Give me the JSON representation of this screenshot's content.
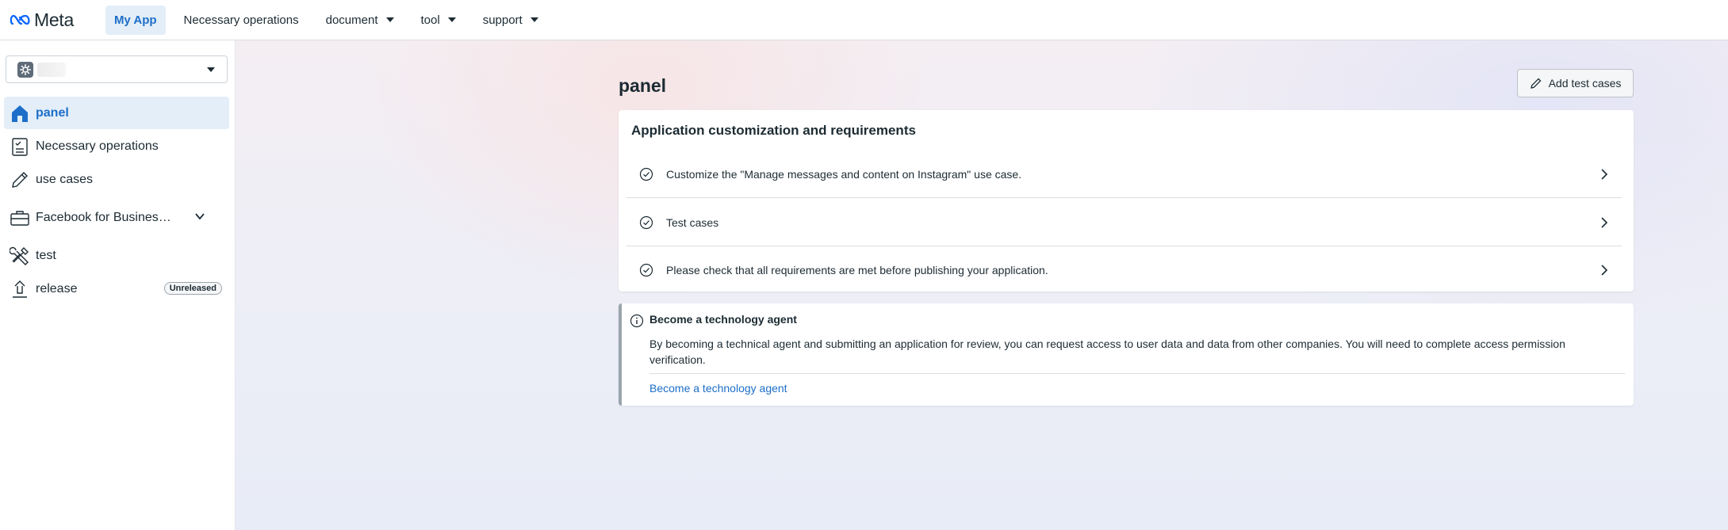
{
  "brand": {
    "name": "Meta"
  },
  "topnav": {
    "items": [
      {
        "label": "My App",
        "active": true,
        "dropdown": false
      },
      {
        "label": "Necessary operations",
        "active": false,
        "dropdown": false
      },
      {
        "label": "document",
        "active": false,
        "dropdown": true
      },
      {
        "label": "tool",
        "active": false,
        "dropdown": true
      },
      {
        "label": "support",
        "active": false,
        "dropdown": true
      }
    ]
  },
  "sidebar": {
    "app_selector": {
      "icon": "gear-icon"
    },
    "items": [
      {
        "label": "panel",
        "icon": "home-icon",
        "active": true
      },
      {
        "label": "Necessary operations",
        "icon": "checklist-icon"
      },
      {
        "label": "use cases",
        "icon": "pencil-icon"
      },
      {
        "label": "Facebook for Busines…",
        "icon": "briefcase-icon",
        "expandable": true
      },
      {
        "label": "test",
        "icon": "tools-icon"
      },
      {
        "label": "release",
        "icon": "upload-icon",
        "badge": "Unreleased"
      }
    ]
  },
  "main": {
    "title": "panel",
    "add_button_label": "Add test cases",
    "requirements_card": {
      "title": "Application customization and requirements",
      "rows": [
        {
          "text": "Customize the \"Manage messages and content on Instagram\" use case."
        },
        {
          "text": "Test cases"
        },
        {
          "text": "Please check that all requirements are met before publishing your application."
        }
      ]
    },
    "agent_card": {
      "title": "Become a technology agent",
      "description": "By becoming a technical agent and submitting an application for review, you can request access to user data and data from other companies. You will need to complete access permission verification.",
      "link_label": "Become a technology agent"
    }
  },
  "colors": {
    "accent": "#1d6ec9",
    "active_bg": "#e3eef8",
    "text": "#1c2b33"
  }
}
